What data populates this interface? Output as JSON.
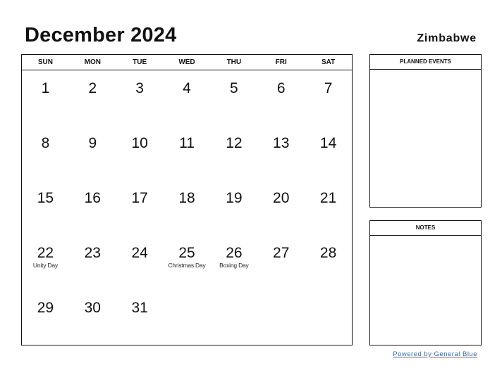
{
  "header": {
    "title": "December 2024",
    "country": "Zimbabwe"
  },
  "calendar": {
    "weekdays": [
      "SUN",
      "MON",
      "TUE",
      "WED",
      "THU",
      "FRI",
      "SAT"
    ],
    "weeks": [
      [
        {
          "day": "1"
        },
        {
          "day": "2"
        },
        {
          "day": "3"
        },
        {
          "day": "4"
        },
        {
          "day": "5"
        },
        {
          "day": "6"
        },
        {
          "day": "7"
        }
      ],
      [
        {
          "day": "8"
        },
        {
          "day": "9"
        },
        {
          "day": "10"
        },
        {
          "day": "11"
        },
        {
          "day": "12"
        },
        {
          "day": "13"
        },
        {
          "day": "14"
        }
      ],
      [
        {
          "day": "15"
        },
        {
          "day": "16"
        },
        {
          "day": "17"
        },
        {
          "day": "18"
        },
        {
          "day": "19"
        },
        {
          "day": "20"
        },
        {
          "day": "21"
        }
      ],
      [
        {
          "day": "22",
          "holiday": "Unity Day"
        },
        {
          "day": "23"
        },
        {
          "day": "24"
        },
        {
          "day": "25",
          "holiday": "Christmas Day"
        },
        {
          "day": "26",
          "holiday": "Boxing Day"
        },
        {
          "day": "27"
        },
        {
          "day": "28"
        }
      ],
      [
        {
          "day": "29"
        },
        {
          "day": "30"
        },
        {
          "day": "31"
        },
        {
          "day": ""
        },
        {
          "day": ""
        },
        {
          "day": ""
        },
        {
          "day": ""
        }
      ]
    ]
  },
  "sidebar": {
    "planned_events_label": "PLANNED EVENTS",
    "notes_label": "NOTES"
  },
  "footer": {
    "powered_by": "Powered by General Blue"
  }
}
